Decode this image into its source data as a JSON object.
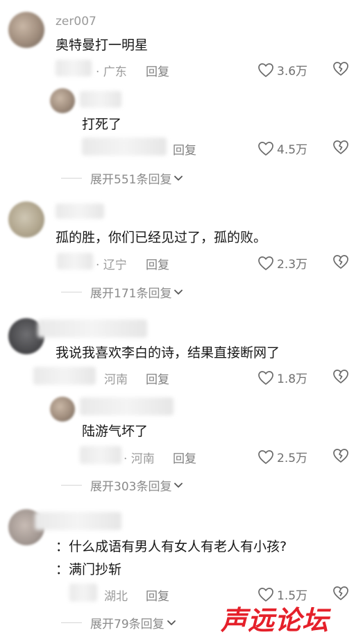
{
  "comments": [
    {
      "username": "zer007",
      "text": "奥特曼打一明星",
      "location": "· 广东",
      "reply_label": "回复",
      "likes": "3.6万"
    },
    {
      "text": "打死了",
      "reply_label": "回复",
      "likes": "4.5万"
    },
    {
      "expand_label": "展开551条回复"
    },
    {
      "text": "孤的胜，你们已经见过了，孤的败。",
      "location": "· 辽宁",
      "reply_label": "回复",
      "likes": "2.3万"
    },
    {
      "expand_label": "展开171条回复"
    },
    {
      "text": "我说我喜欢李白的诗，结果直接断网了",
      "location": "河南",
      "reply_label": "回复",
      "likes": "1.8万"
    },
    {
      "text": "陆游气坏了",
      "location": "· 河南",
      "reply_label": "回复",
      "likes": "2.5万"
    },
    {
      "expand_label": "展开303条回复"
    },
    {
      "text_line1": "：什么成语有男人有女人有老人有小孩?",
      "text_line2": "：满门抄斩",
      "location": "湖北",
      "reply_label": "回复",
      "likes": "1.5万"
    },
    {
      "expand_label": "展开79条回复"
    }
  ],
  "watermark": "声远论坛",
  "icons": [
    "heart-outline-icon",
    "broken-heart-icon",
    "chevron-down-icon"
  ]
}
